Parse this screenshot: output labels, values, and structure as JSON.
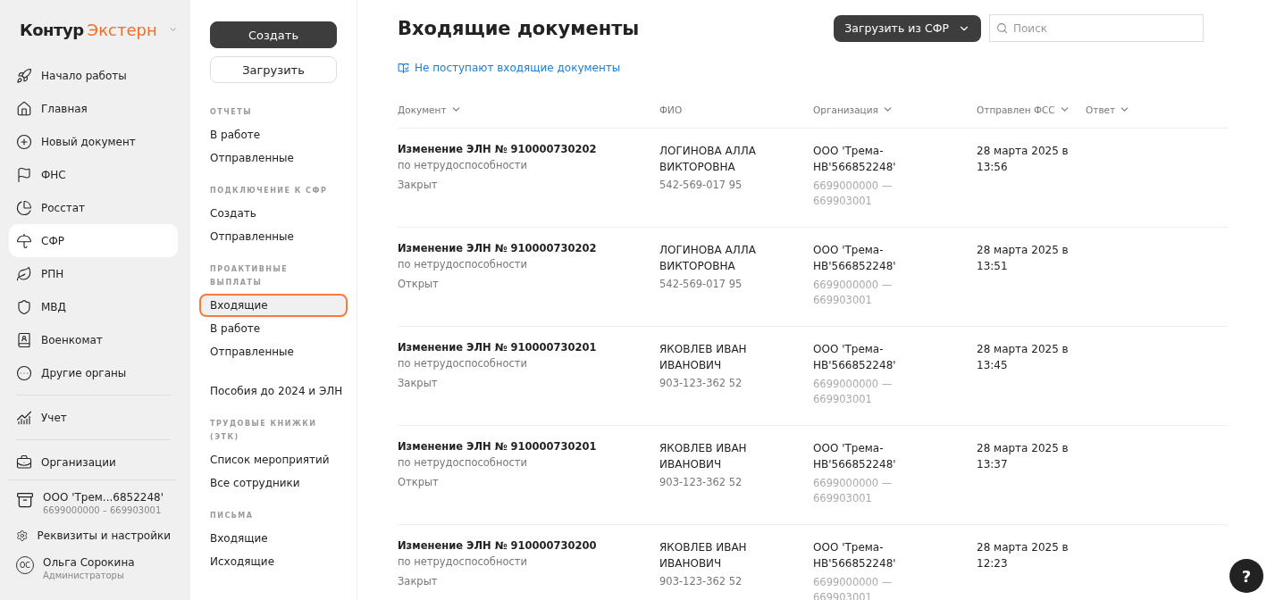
{
  "logo": {
    "brand": "Контур",
    "product": "Экстерн"
  },
  "nav": {
    "sections": [
      {
        "items": [
          {
            "label": "Начало работы",
            "selected": false
          },
          {
            "label": "Главная",
            "selected": false
          },
          {
            "label": "Новый документ",
            "selected": false
          },
          {
            "label": "ФНС",
            "selected": false
          },
          {
            "label": "Росстат",
            "selected": false
          },
          {
            "label": "СФР",
            "selected": true
          },
          {
            "label": "РПН",
            "selected": false
          },
          {
            "label": "МВД",
            "selected": false
          },
          {
            "label": "Военкомат",
            "selected": false
          },
          {
            "label": "Другие органы",
            "selected": false
          }
        ]
      },
      {
        "items": [
          {
            "label": "Учет",
            "selected": false
          }
        ]
      },
      {
        "items": [
          {
            "label": "Организации",
            "selected": false
          }
        ]
      }
    ]
  },
  "organization": {
    "name": "ООО 'Трем...6852248'",
    "codes": "6699000000 – 669903001"
  },
  "settings": {
    "label": "Реквизиты и настройки"
  },
  "user": {
    "initials": "ОС",
    "name": "Ольга Сорокина",
    "role": "Администраторы"
  },
  "subnav": {
    "buttons": [
      {
        "label": "Создать",
        "kind": "primary"
      },
      {
        "label": "Загрузить",
        "kind": "secondary"
      }
    ],
    "sections": [
      {
        "heading": "ОТЧЕТЫ",
        "items": [
          {
            "label": "В работе",
            "selected": false
          },
          {
            "label": "Отправленные",
            "selected": false
          }
        ]
      },
      {
        "heading": "ПОДКЛЮЧЕНИЕ К СФР",
        "items": [
          {
            "label": "Создать",
            "selected": false
          },
          {
            "label": "Отправленные",
            "selected": false
          }
        ]
      },
      {
        "heading": "ПРОАКТИВНЫЕ ВЫПЛАТЫ",
        "items": [
          {
            "label": "Входящие",
            "selected": true
          },
          {
            "label": "В работе",
            "selected": false
          },
          {
            "label": "Отправленные",
            "selected": false
          }
        ]
      },
      {
        "items": [
          {
            "label": "Пособия до 2024 и ЭЛН",
            "selected": false
          }
        ]
      },
      {
        "heading": "ТРУДОВЫЕ КНИЖКИ (ЭТК)",
        "items": [
          {
            "label": "Список мероприятий",
            "selected": false
          },
          {
            "label": "Все сотрудники",
            "selected": false
          }
        ]
      },
      {
        "heading": "ПИСЬМА",
        "items": [
          {
            "label": "Входящие",
            "selected": false
          },
          {
            "label": "Исходящие",
            "selected": false
          }
        ]
      }
    ]
  },
  "page": {
    "title": "Входящие документы",
    "load_button": "Загрузить из СФР",
    "search": {
      "placeholder": "Поиск"
    },
    "help_link": "Не поступают входящие документы"
  },
  "table": {
    "columns": [
      {
        "label": "Документ",
        "sortable": true
      },
      {
        "label": "ФИО",
        "sortable": false
      },
      {
        "label": "Организация",
        "sortable": true
      },
      {
        "label": "Отправлен ФСС",
        "sortable": true
      },
      {
        "label": "Ответ",
        "sortable": true
      }
    ],
    "rows": [
      {
        "document": "Изменение ЭЛН № 910000730202",
        "type": "по нетрудоспособности",
        "status": "Закрыт",
        "person": "ЛОГИНОВА АЛЛА ВИКТОРОВНА",
        "snils": "542-569-017 95",
        "org": "ООО 'Трема-НВ'566852248'",
        "org_codes": "6699000000 — 669903001",
        "sent": "28 марта 2025 в 13:56"
      },
      {
        "document": "Изменение ЭЛН № 910000730202",
        "type": "по нетрудоспособности",
        "status": "Открыт",
        "person": "ЛОГИНОВА АЛЛА ВИКТОРОВНА",
        "snils": "542-569-017 95",
        "org": "ООО 'Трема-НВ'566852248'",
        "org_codes": "6699000000 — 669903001",
        "sent": "28 марта 2025 в 13:51"
      },
      {
        "document": "Изменение ЭЛН № 910000730201",
        "type": "по нетрудоспособности",
        "status": "Закрыт",
        "person": "ЯКОВЛЕВ ИВАН ИВАНОВИЧ",
        "snils": "903-123-362 52",
        "org": "ООО 'Трема-НВ'566852248'",
        "org_codes": "6699000000 — 669903001",
        "sent": "28 марта 2025 в 13:45"
      },
      {
        "document": "Изменение ЭЛН № 910000730201",
        "type": "по нетрудоспособности",
        "status": "Открыт",
        "person": "ЯКОВЛЕВ ИВАН ИВАНОВИЧ",
        "snils": "903-123-362 52",
        "org": "ООО 'Трема-НВ'566852248'",
        "org_codes": "6699000000 — 669903001",
        "sent": "28 марта 2025 в 13:37"
      },
      {
        "document": "Изменение ЭЛН № 910000730200",
        "type": "по нетрудоспособности",
        "status": "Закрыт",
        "person": "ЯКОВЛЕВ ИВАН ИВАНОВИЧ",
        "snils": "903-123-362 52",
        "org": "ООО 'Трема-НВ'566852248'",
        "org_codes": "6699000000 — 669903001",
        "sent": "28 марта 2025 в 12:23"
      }
    ]
  },
  "help_button": "?"
}
